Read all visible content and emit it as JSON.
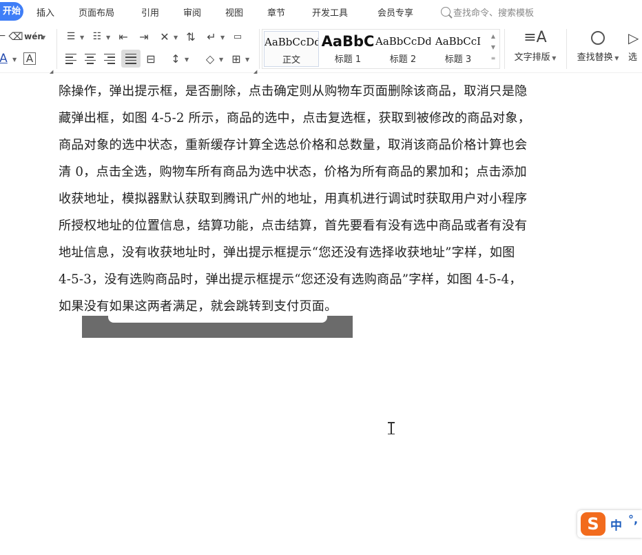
{
  "menu": {
    "start": "开始",
    "items": [
      "插入",
      "页面布局",
      "引用",
      "审阅",
      "视图",
      "章节",
      "开发工具",
      "会员专享"
    ],
    "search_placeholder": "查找命令、搜索模板"
  },
  "ribbon": {
    "styles": [
      {
        "sample": "AaBbCcDd",
        "label": "正文"
      },
      {
        "sample": "AaBbC",
        "label": "标题 1"
      },
      {
        "sample": "AaBbCcDd",
        "label": "标题 2"
      },
      {
        "sample": "AaBbCcI",
        "label": "标题 3"
      }
    ],
    "text_layout": "文字排版",
    "find_replace": "查找替换",
    "select_partial": "选",
    "phonetic_glyph": "wén",
    "font_color_glyph": "A",
    "char_border_glyph": "A"
  },
  "document": {
    "lines": [
      "除操作，弹出提示框，是否删除，点击确定则从购物车页面删除该商品，取消只是隐",
      "藏弹出框，如图 4-5-2 所示，商品的选中，点击复选框，获取到被修改的商品对象，",
      "商品对象的选中状态，重新缓存计算全选总价格和总数量，取消该商品价格计算也会",
      "清 0，点击全选，购物车所有商品为选中状态，价格为所有商品的累加和；点击添加",
      "收获地址，模拟器默认获取到腾讯广州的地址，用真机进行调试时获取用户对小程序",
      "所授权地址的位置信息，结算功能，点击结算，首先要看有没有选中商品或者有没有",
      "地址信息，没有收获地址时，弹出提示框提示“您还没有选择收获地址”字样，如图",
      "4-5-3，没有选购商品时，弹出提示框提示“您还没有选购商品”字样，如图 4-5-4，",
      "如果没有如果这两者满足，就会跳转到支付页面。"
    ]
  },
  "ime": {
    "logo": "S",
    "lang": "中",
    "punct": "°,"
  },
  "colors": {
    "accent": "#3f7ef7",
    "ime_orange": "#f26b1d",
    "ime_blue": "#1f5fbf",
    "embedded_gray": "#6b6b6b"
  }
}
